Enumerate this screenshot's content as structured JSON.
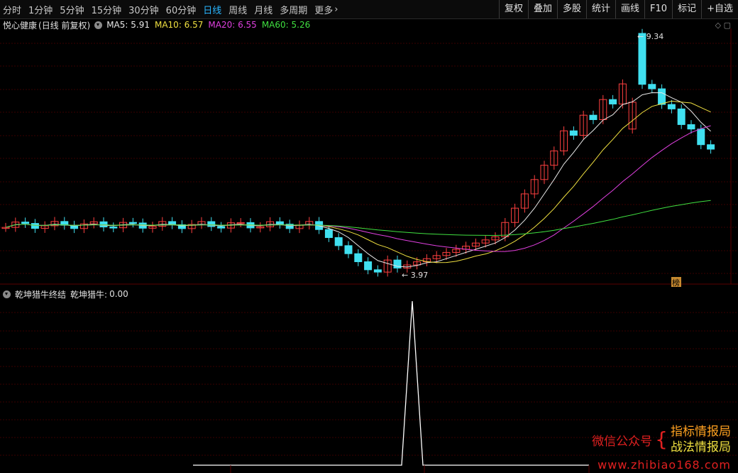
{
  "toolbar": {
    "periods": [
      "分时",
      "1分钟",
      "5分钟",
      "15分钟",
      "30分钟",
      "60分钟",
      "日线",
      "周线",
      "月线",
      "多周期",
      "更多"
    ],
    "active_period": "日线",
    "more_chevron": "›",
    "buttons": [
      "复权",
      "叠加",
      "多股",
      "统计",
      "画线",
      "F10",
      "标记",
      "+自选"
    ]
  },
  "main_panel": {
    "stock_name": "悦心健康",
    "mode": "(日线 前复权)",
    "ma": [
      {
        "label": "MA5:",
        "value": "5.91",
        "color": "#e8e8e8"
      },
      {
        "label": "MA10:",
        "value": "6.57",
        "color": "#f0e040"
      },
      {
        "label": "MA20:",
        "value": "6.55",
        "color": "#e040e0"
      },
      {
        "label": "MA60:",
        "value": "5.26",
        "color": "#40e040"
      }
    ],
    "high_label": "9.34",
    "low_label": "3.97",
    "badge": "榜",
    "corner_icons": "◇ ▢"
  },
  "sub_panel": {
    "indicator_name": "乾坤猎牛终结",
    "value_label": "乾坤猎牛:",
    "value": "0.00"
  },
  "watermark": {
    "left": "微信公众号",
    "line1": "指标情报局",
    "line2": "战法情报局",
    "url": "www.zhibiao168.com"
  },
  "colors": {
    "up": "#ff4040",
    "down": "#40e0f0",
    "ma5": "#e8e8e8",
    "ma10": "#f0e040",
    "ma20": "#e040e0",
    "ma60": "#40e040",
    "active": "#29b6ff",
    "grid": "#3a0000"
  }
}
